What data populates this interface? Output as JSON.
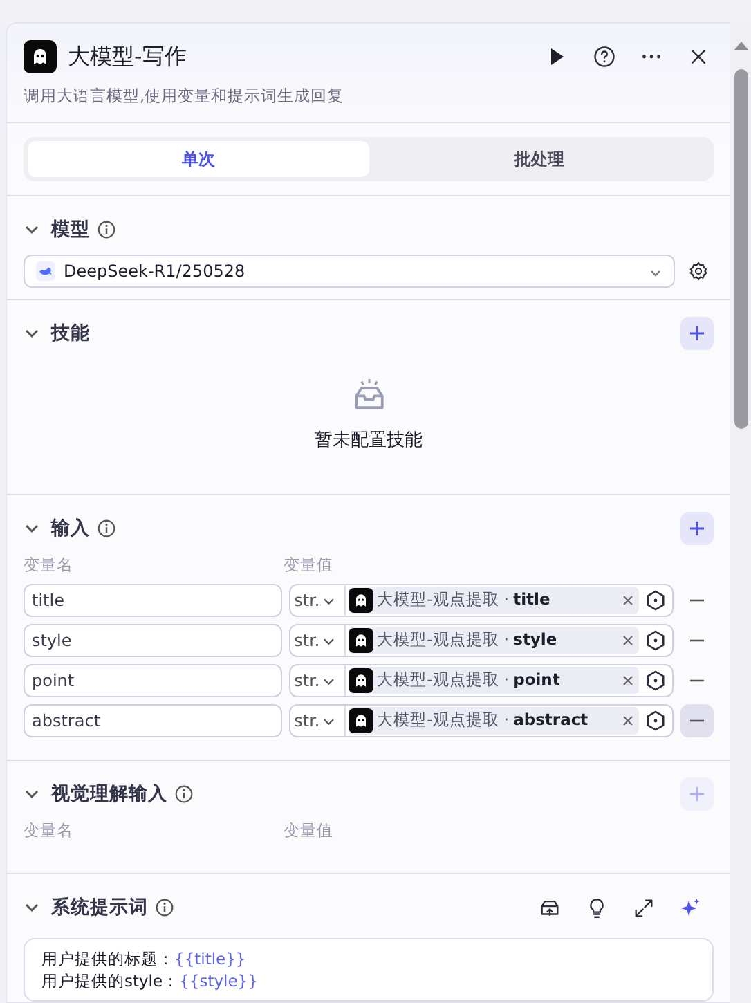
{
  "header": {
    "title": "大模型-写作",
    "description": "调用大语言模型,使用变量和提示词生成回复"
  },
  "tabs": [
    {
      "label": "单次",
      "selected": true
    },
    {
      "label": "批处理",
      "selected": false
    }
  ],
  "model_section": {
    "title": "模型",
    "expanded": true,
    "model": "DeepSeek-R1/250528"
  },
  "skills_section": {
    "title": "技能",
    "expanded": true,
    "add_disabled": false,
    "empty_text": "暂未配置技能"
  },
  "input_section": {
    "title": "输入",
    "expanded": true,
    "add_disabled": false,
    "columns": [
      "变量名",
      "变量值"
    ],
    "rows": [
      {
        "name": "title",
        "type": "str.",
        "source": "大模型-观点提取 ·",
        "field": "title",
        "remove_highlighted": false
      },
      {
        "name": "style",
        "type": "str.",
        "source": "大模型-观点提取 ·",
        "field": "style",
        "remove_highlighted": false
      },
      {
        "name": "point",
        "type": "str.",
        "source": "大模型-观点提取 ·",
        "field": "point",
        "remove_highlighted": false
      },
      {
        "name": "abstract",
        "type": "str.",
        "source": "大模型-观点提取 ·",
        "field": "abstract",
        "remove_highlighted": true
      }
    ]
  },
  "vision_section": {
    "title": "视觉理解输入",
    "expanded": true,
    "add_disabled": true,
    "columns": [
      "变量名",
      "变量值"
    ]
  },
  "prompt_section": {
    "title": "系统提示词",
    "expanded": true,
    "lines": [
      {
        "text": "用户提供的标题：",
        "variable": "{{title}}"
      },
      {
        "text": "用户提供的style：",
        "variable": "{{style}}"
      }
    ]
  }
}
